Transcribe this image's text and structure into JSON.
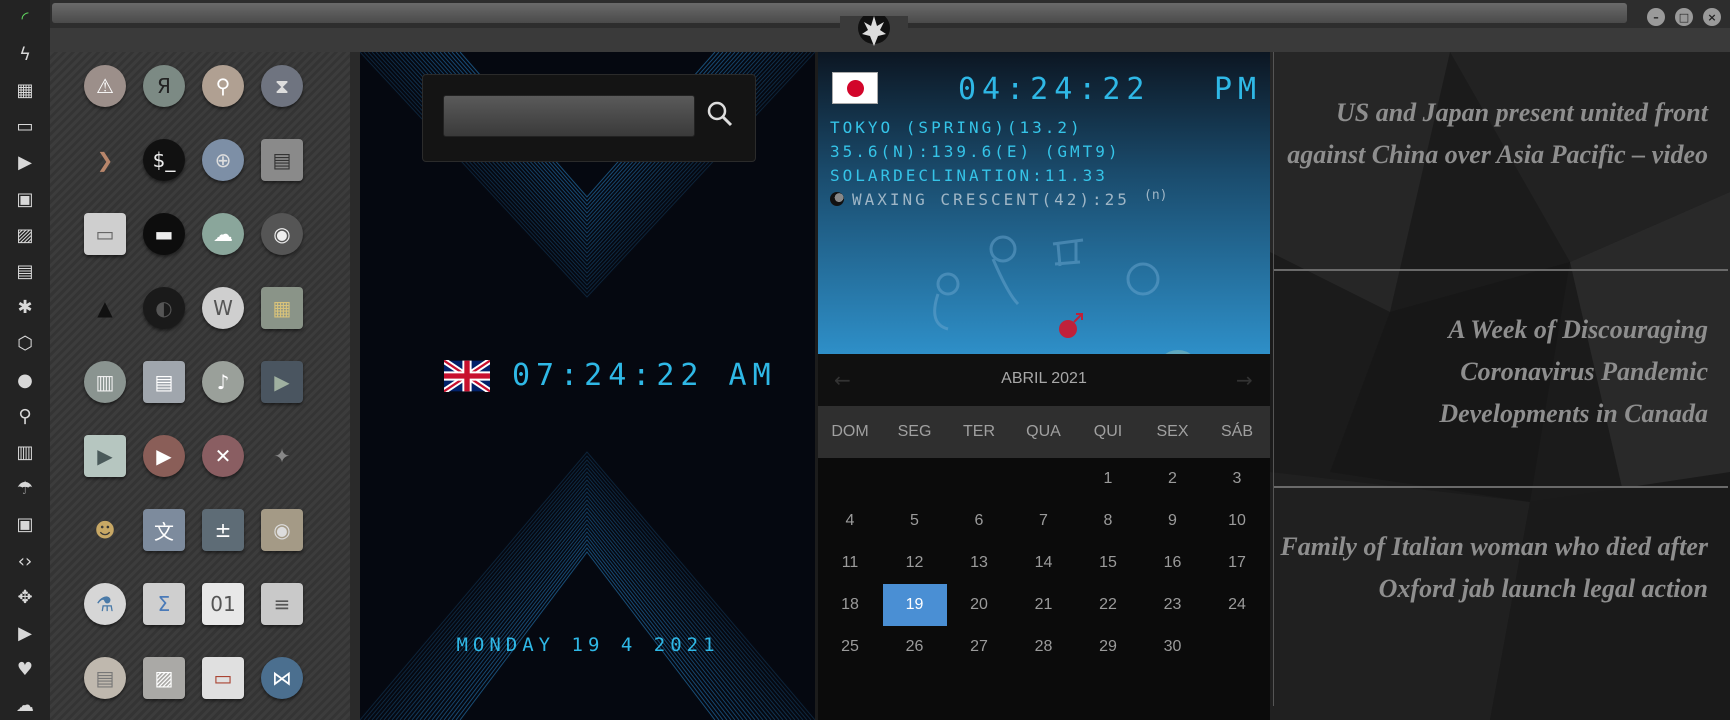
{
  "colors": {
    "accent": "#2fb8e6",
    "selected_day": "#4a8fd4",
    "wifi": "#5fd35f"
  },
  "dock": {
    "icons": [
      "wifi-icon",
      "lightning-icon",
      "windows-icon",
      "archive-icon",
      "play-icon",
      "map-book-icon",
      "image-icon",
      "news-icon",
      "rebel-icon",
      "hex-icon",
      "globe-icon",
      "search-icon",
      "map-icon",
      "umbrella-icon",
      "contact-icon",
      "code-icon",
      "expand-icon",
      "youtube-icon",
      "heart-icon",
      "cloud-icon"
    ]
  },
  "apps": [
    [
      "warning",
      "yandex",
      "search",
      "hourglass"
    ],
    [
      "arrow",
      "terminal",
      "globe",
      "server"
    ],
    [
      "window",
      "ring",
      "cloud-lock",
      "github"
    ],
    [
      "starfleet",
      "death-star",
      "wikipedia",
      "world-map"
    ],
    [
      "books",
      "document",
      "music",
      "video"
    ],
    [
      "play-store",
      "youtube",
      "close",
      "droid"
    ],
    [
      "c3po",
      "translate",
      "calculator",
      "camera"
    ],
    [
      "lab",
      "sigma",
      "binary-file",
      "text"
    ],
    [
      "text-file",
      "image-viewer",
      "presentation",
      "vscode"
    ]
  ],
  "uk_clock": {
    "time": "07:24:22 AM",
    "date": "MONDAY 19 4 2021"
  },
  "jp_clock": {
    "time": "04:24:22",
    "ampm": "PM",
    "line1": "TOKYO (SPRING)(13.2)",
    "line2": "35.6(N):139.6(E) (GMT9)",
    "line3": "SOLARDECLINATION:11.33",
    "line4": "WAXING CRESCENT(42):25",
    "line4_suffix": "(n)"
  },
  "calendar": {
    "month_label": "ABRIL 2021",
    "weekdays": [
      "DOM",
      "SEG",
      "TER",
      "QUA",
      "QUI",
      "SEX",
      "SÁB"
    ],
    "selected_day": 19,
    "weeks": [
      [
        "",
        "",
        "",
        "",
        "1",
        "2",
        "3"
      ],
      [
        "4",
        "5",
        "6",
        "7",
        "8",
        "9",
        "10"
      ],
      [
        "11",
        "12",
        "13",
        "14",
        "15",
        "16",
        "17"
      ],
      [
        "18",
        "19",
        "20",
        "21",
        "22",
        "23",
        "24"
      ],
      [
        "25",
        "26",
        "27",
        "28",
        "29",
        "30",
        ""
      ]
    ]
  },
  "news": [
    {
      "headline": "US and Japan present united front against China over Asia Pacific – video"
    },
    {
      "headline": "A Week of Discouraging Coronavirus Pandemic Developments in Canada"
    },
    {
      "headline": "Family of Italian woman who died after Oxford jab launch legal action"
    }
  ]
}
